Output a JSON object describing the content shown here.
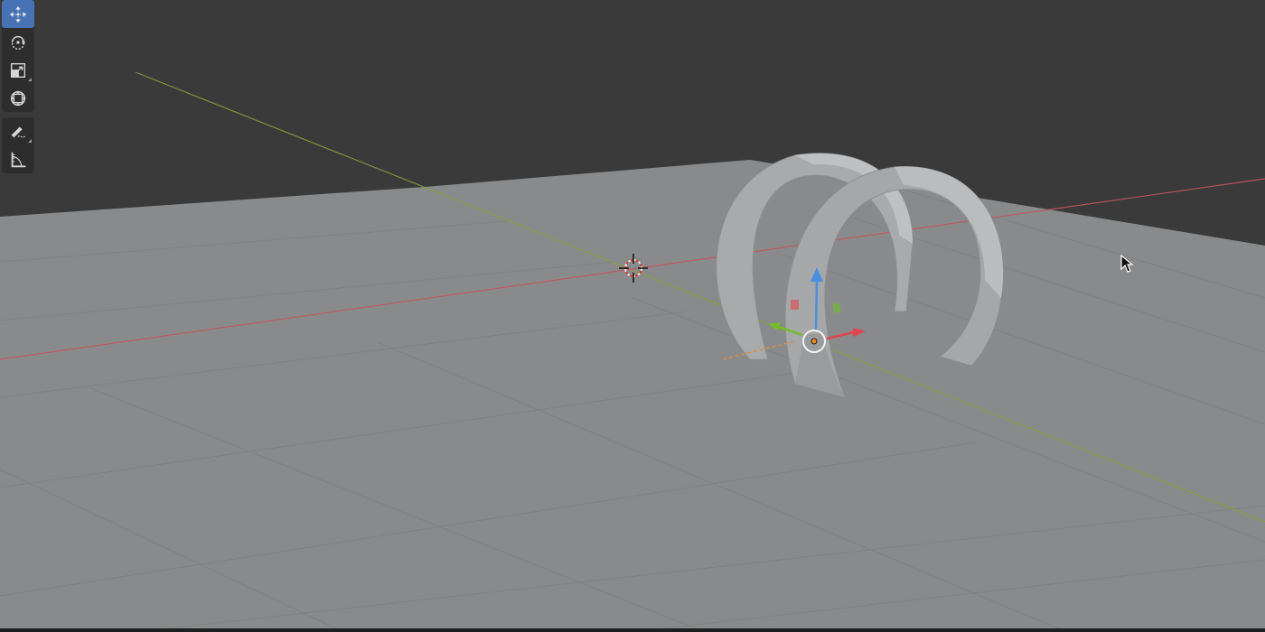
{
  "viewport": {
    "colors": {
      "background": "#3a3a3a",
      "floor": "#898a8b",
      "grid_line": "#7e7f80",
      "axis_x": "#c4555e",
      "axis_y": "#8aa13a",
      "gizmo_z": "#4b8fe0",
      "gizmo_y": "#6fbf2a",
      "gizmo_x": "#e0464f",
      "toolbar_bg": "#2d2d2d",
      "tool_active": "#4772b3"
    }
  },
  "toolbar": {
    "tools": [
      {
        "name": "move-tool",
        "icon": "move-icon",
        "active": true,
        "has_submenu": false
      },
      {
        "name": "rotate-tool",
        "icon": "rotate-icon",
        "active": false,
        "has_submenu": false
      },
      {
        "name": "scale-tool",
        "icon": "scale-icon",
        "active": false,
        "has_submenu": true
      },
      {
        "name": "transform-tool",
        "icon": "transform-icon",
        "active": false,
        "has_submenu": false
      },
      {
        "name": "annotate-tool",
        "icon": "annotate-icon",
        "active": false,
        "has_submenu": true
      },
      {
        "name": "measure-tool",
        "icon": "measure-icon",
        "active": false,
        "has_submenu": false
      }
    ]
  },
  "scene": {
    "objects": [
      "ring-1",
      "ring-2"
    ],
    "selected": "ring-2"
  }
}
